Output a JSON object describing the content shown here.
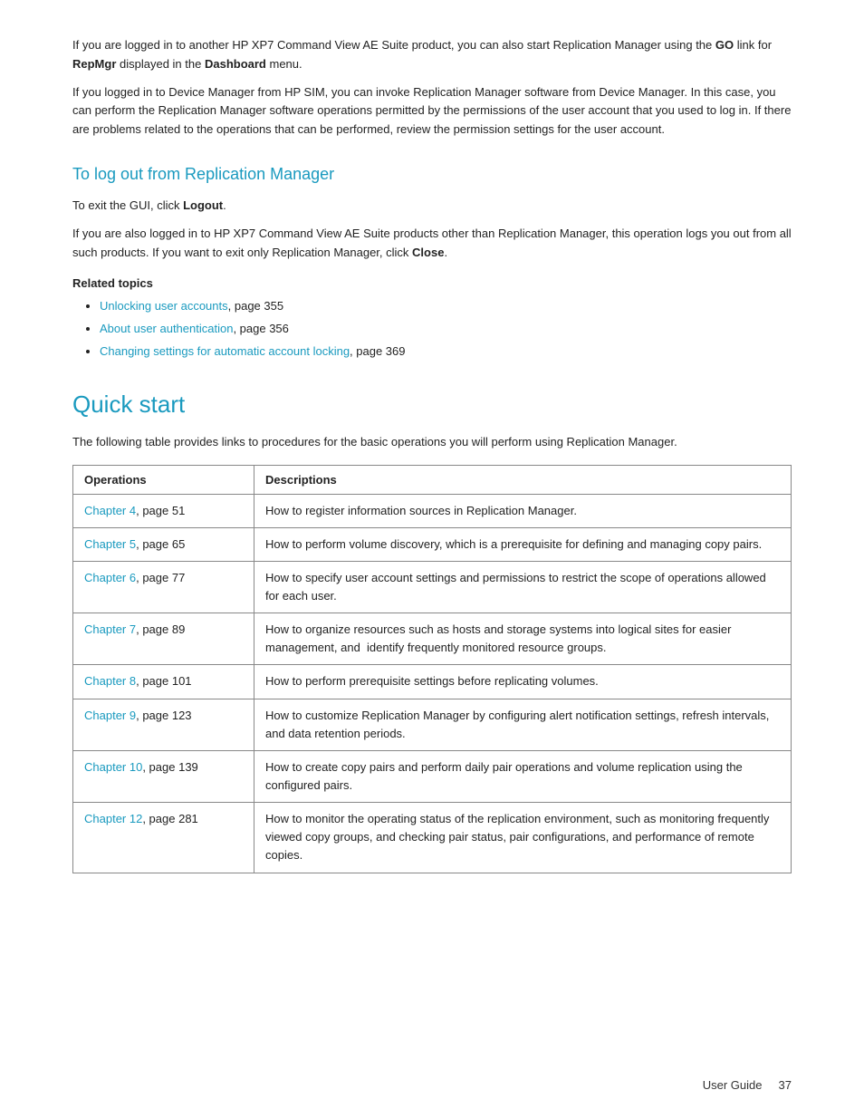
{
  "page": {
    "footer": {
      "label": "User Guide",
      "page_number": "37"
    },
    "intro_paragraphs": [
      {
        "id": "intro1",
        "text_parts": [
          {
            "text": "If you are logged in to another HP XP7 Command View AE Suite product, you can also start Replication Manager using the "
          },
          {
            "text": "GO",
            "bold": true
          },
          {
            "text": " link for "
          },
          {
            "text": "RepMgr",
            "bold": true
          },
          {
            "text": " displayed in the "
          },
          {
            "text": "Dashboard",
            "bold": true
          },
          {
            "text": " menu."
          }
        ]
      },
      {
        "id": "intro2",
        "text": "If you logged in to Device Manager from HP SIM, you can invoke Replication Manager software from Device Manager. In this case, you can perform the Replication Manager software operations permitted by the permissions of the user account that you used to log in. If there are problems related to the operations that can be performed, review the permission settings for the user account."
      }
    ],
    "logout_section": {
      "heading": "To log out from Replication Manager",
      "para1_parts": [
        {
          "text": "To exit the GUI, click "
        },
        {
          "text": "Logout",
          "bold": true
        },
        {
          "text": "."
        }
      ],
      "para2_parts": [
        {
          "text": "If you are also logged in to HP XP7 Command View AE Suite products other than Replication Manager, this operation logs you out from all such products. If you want to exit only Replication Manager, click "
        },
        {
          "text": "Close",
          "bold": true
        },
        {
          "text": "."
        }
      ],
      "related_topics_heading": "Related topics",
      "related_topics": [
        {
          "link_text": "Unlocking user accounts",
          "page_text": ", page 355"
        },
        {
          "link_text": "About user authentication",
          "page_text": ", page 356"
        },
        {
          "link_text": "Changing settings for automatic account locking",
          "page_text": ", page 369"
        }
      ]
    },
    "quick_start_section": {
      "heading": "Quick start",
      "intro": "The following table provides links to procedures for the basic operations you will perform using Replication Manager.",
      "table": {
        "headers": [
          "Operations",
          "Descriptions"
        ],
        "rows": [
          {
            "link_text": "Chapter 4",
            "page_text": ", page 51",
            "description": "How to register information sources in Replication Manager."
          },
          {
            "link_text": "Chapter 5",
            "page_text": ", page 65",
            "description": "How to perform volume discovery, which is a prerequisite for defining and managing copy pairs."
          },
          {
            "link_text": "Chapter 6",
            "page_text": ", page 77",
            "description": "How to specify user account settings and permissions to restrict the scope of operations allowed for each user."
          },
          {
            "link_text": "Chapter 7",
            "page_text": ", page 89",
            "description": "How to organize resources such as hosts and storage systems into logical sites for easier management, and  identify frequently monitored resource groups."
          },
          {
            "link_text": "Chapter 8",
            "page_text": ", page 101",
            "description": "How to perform prerequisite settings before replicating volumes."
          },
          {
            "link_text": "Chapter 9",
            "page_text": ", page 123",
            "description": "How to customize Replication Manager by configuring alert notification settings, refresh intervals, and data retention periods."
          },
          {
            "link_text": "Chapter 10",
            "page_text": ", page 139",
            "description": "How to create copy pairs and perform daily pair operations and volume replication using the configured pairs."
          },
          {
            "link_text": "Chapter 12",
            "page_text": ", page 281",
            "description": "How to monitor the operating status of the replication environment, such as monitoring frequently viewed copy groups, and checking pair status, pair configurations, and performance of remote copies."
          }
        ]
      }
    }
  }
}
